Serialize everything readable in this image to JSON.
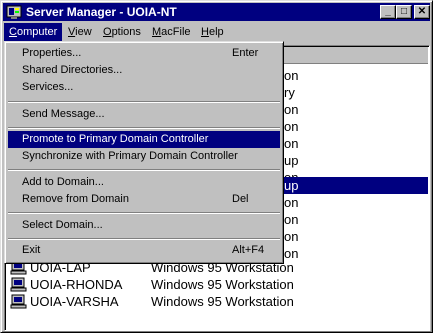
{
  "window": {
    "title": "Server Manager - UOIA-NT",
    "controls": {
      "minimize": "_",
      "maximize": "□",
      "close": "✕"
    }
  },
  "menubar": [
    {
      "label": "Computer",
      "mnemonic": "C"
    },
    {
      "label": "View",
      "mnemonic": "V"
    },
    {
      "label": "Options",
      "mnemonic": "O"
    },
    {
      "label": "MacFile",
      "mnemonic": "M"
    },
    {
      "label": "Help",
      "mnemonic": "H"
    }
  ],
  "computer_menu": {
    "items": [
      {
        "label": "Properties...",
        "shortcut": "Enter"
      },
      {
        "label": "Shared Directories...",
        "shortcut": ""
      },
      {
        "label": "Services...",
        "shortcut": ""
      },
      {
        "label": "Send Message...",
        "shortcut": ""
      },
      {
        "label": "Promote to Primary Domain Controller",
        "shortcut": "",
        "highlighted": true
      },
      {
        "label": "Synchronize with Primary Domain Controller",
        "shortcut": ""
      },
      {
        "label": "Add to Domain...",
        "shortcut": ""
      },
      {
        "label": "Remove from Domain",
        "shortcut": "Del"
      },
      {
        "label": "Select Domain...",
        "shortcut": ""
      },
      {
        "label": "Exit",
        "shortcut": "Alt+F4"
      }
    ]
  },
  "computers": {
    "visible_type_fragments": [
      "on",
      "ry",
      "on",
      "on",
      "on",
      "up",
      "on",
      "up",
      "on",
      "on",
      "on",
      "on"
    ],
    "selected_fragment_index": 7,
    "rows": [
      {
        "name": "UOIA-LAP",
        "type": "Windows 95 Workstation"
      },
      {
        "name": "UOIA-RHONDA",
        "type": "Windows 95 Workstation"
      },
      {
        "name": "UOIA-VARSHA",
        "type": "Windows 95 Workstation"
      }
    ]
  },
  "colors": {
    "title_bar": "#000080",
    "selection": "#000080",
    "face": "#c0c0c0"
  }
}
